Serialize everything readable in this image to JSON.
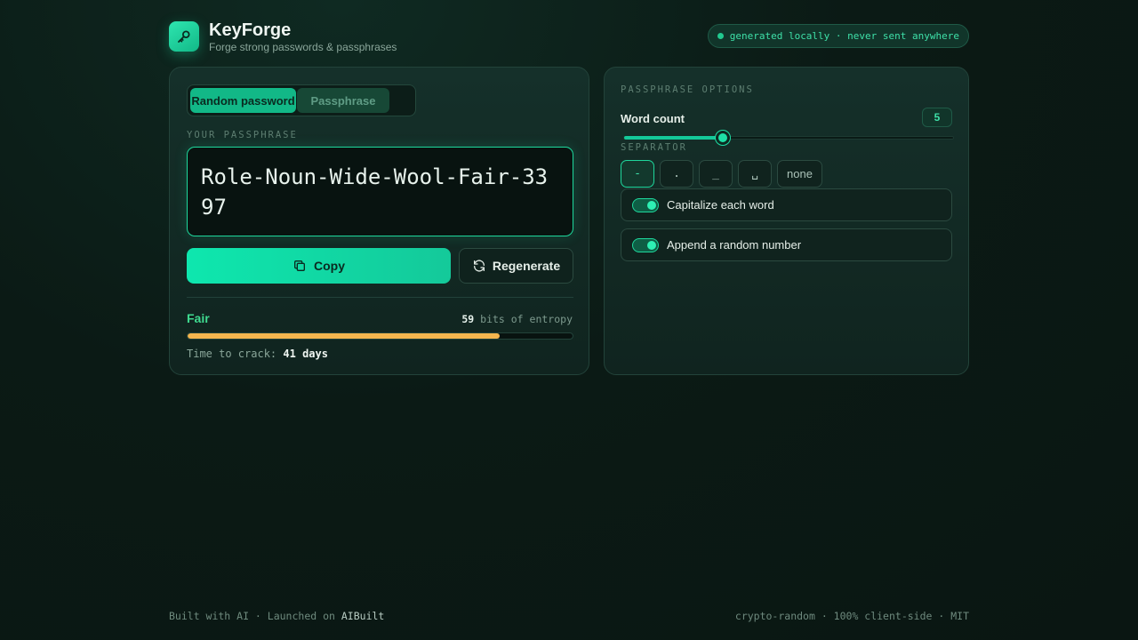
{
  "app": {
    "title": "KeyForge",
    "subtitle": "Forge strong passwords & passphrases",
    "status": "generated locally · never sent anywhere"
  },
  "tabs": [
    {
      "label": "Random password",
      "active": true
    },
    {
      "label": "Passphrase",
      "active": false
    }
  ],
  "output": {
    "label": "YOUR PASSPHRASE",
    "value": "Role-Noun-Wide-Wool-Fair-3397"
  },
  "actions": {
    "copy_label": "Copy",
    "regenerate_label": "Regenerate"
  },
  "strength": {
    "label": "Fair",
    "entropy_bits": "59",
    "entropy_suffix": "bits of entropy",
    "meter_fraction": 0.81,
    "meter_color": "#f4b64e",
    "crack_prefix": "Time to crack:",
    "crack_time": "41 days"
  },
  "options": {
    "heading": "PASSPHRASE OPTIONS",
    "word_count_label": "Word count",
    "word_count": "5",
    "word_count_fraction": 0.3,
    "separator_label": "SEPARATOR",
    "separators": [
      {
        "label": "-",
        "active": true
      },
      {
        "label": ".",
        "active": false
      },
      {
        "label": "_",
        "active": false
      },
      {
        "label": "␣",
        "active": false
      },
      {
        "label": "none",
        "active": false
      }
    ],
    "capitalize_label": "Capitalize each word",
    "capitalize_on": true,
    "append_number_label": "Append a random number",
    "append_number_on": true
  },
  "footer": {
    "left_prefix": "Built with AI · Launched on ",
    "left_link": "AIBuilt",
    "right": "crypto-random · 100% client-side · MIT"
  },
  "colors": {
    "accent": "#1ed79c",
    "strength_text": "#3fd98f",
    "background": "#0b1a15"
  }
}
